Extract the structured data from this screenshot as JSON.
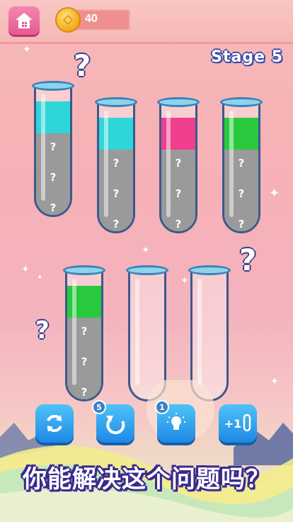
{
  "header": {
    "coins": "40"
  },
  "stage_label": "Stage 5",
  "colors": {
    "cyan": "#2fd6d8",
    "pink": "#ef3f8d",
    "green": "#29c93d",
    "hidden": "#9a9a9a"
  },
  "tubes": [
    {
      "top": "cyan",
      "hidden_count": 3
    },
    {
      "top": "cyan",
      "hidden_count": 3
    },
    {
      "top": "pink",
      "hidden_count": 3
    },
    {
      "top": "green",
      "hidden_count": 3
    },
    {
      "top": "green",
      "hidden_count": 3
    },
    {
      "top": null,
      "hidden_count": 0
    },
    {
      "top": null,
      "hidden_count": 0
    }
  ],
  "question_mark": "?",
  "tools": {
    "restart_icon": "restart-icon",
    "undo_icon": "undo-icon",
    "undo_badge": "5",
    "hint_icon": "lightbulb-icon",
    "hint_badge": "1",
    "add_tube_icon": "add-tube-icon",
    "add_tube_label": "+1"
  },
  "caption": "你能解决这个问题吗？"
}
